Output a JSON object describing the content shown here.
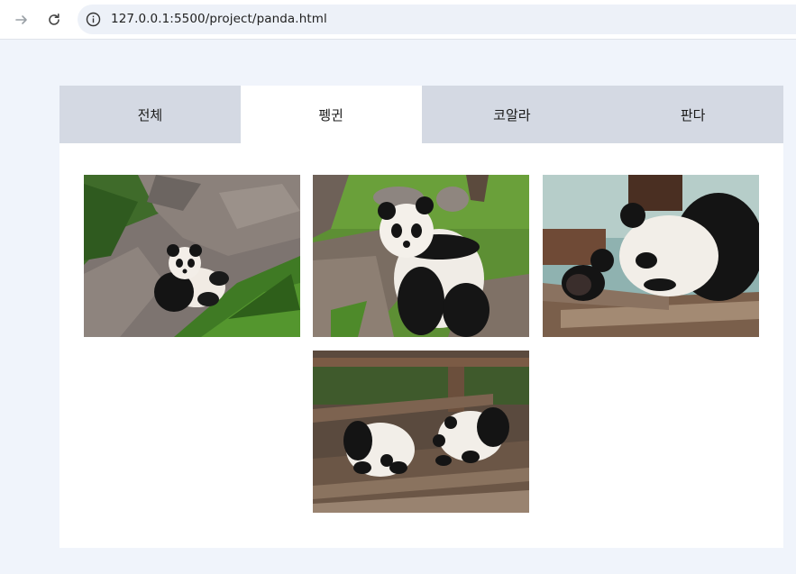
{
  "browser": {
    "url": "127.0.0.1:5500/project/panda.html",
    "icons": [
      "arrow-forward-icon",
      "reload-icon",
      "info-icon"
    ]
  },
  "tabs": [
    {
      "label": "전체",
      "active": false
    },
    {
      "label": "펭귄",
      "active": true
    },
    {
      "label": "코알라",
      "active": false
    },
    {
      "label": "판다",
      "active": false
    }
  ],
  "gallery": {
    "photos": [
      {
        "subject": "panda cub lying on rocks and grass"
      },
      {
        "subject": "panda sitting on logs in grass"
      },
      {
        "subject": "panda resting on logs"
      },
      {
        "subject": "two panda cubs on wooden floor"
      }
    ]
  },
  "colors": {
    "page_bg": "#f0f4fb",
    "tab_inactive": "#d4d9e3",
    "tab_active": "#ffffff"
  }
}
